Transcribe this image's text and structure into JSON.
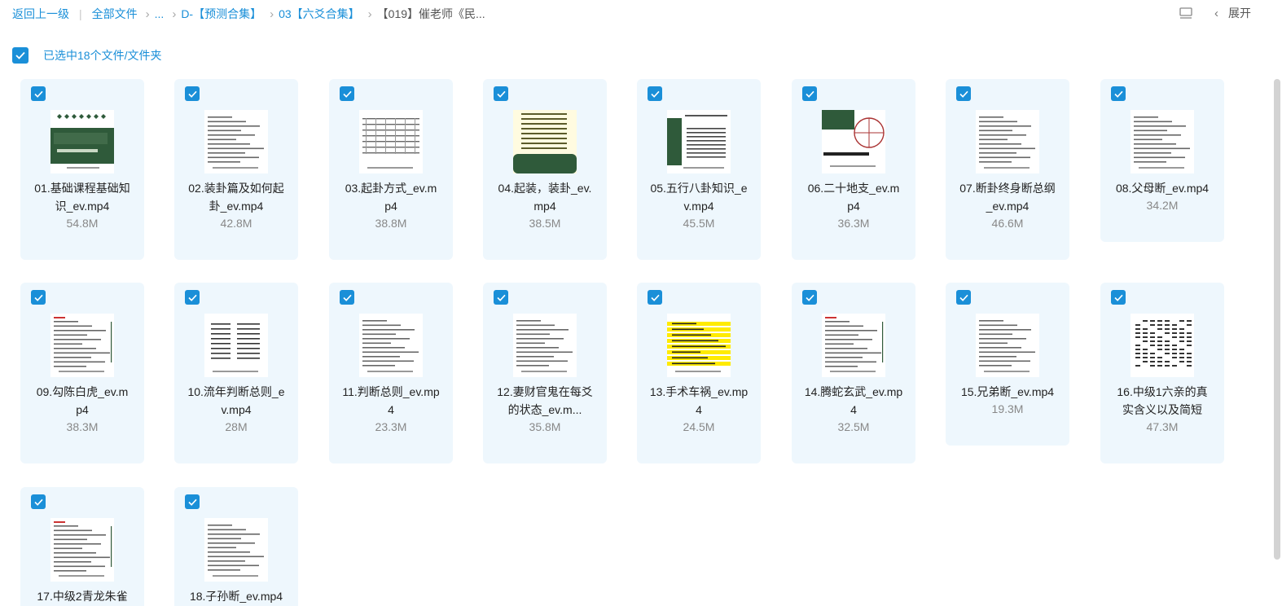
{
  "breadcrumb": {
    "back": "返回上一级",
    "root": "全部文件",
    "ellipsis": "...",
    "level1": "D-【预测合集】",
    "level2": "03【六爻合集】",
    "current": "【019】催老师《民..."
  },
  "toolbar": {
    "expand_label": "展开",
    "view_icon": "list-view-icon",
    "collapse_icon": "chevron-left-icon"
  },
  "selection": {
    "label": "已选中18个文件/文件夹",
    "checked": true
  },
  "accent_color": "#1a8fd8",
  "files": [
    {
      "name": "01.基础课程基础知识_ev.mp4",
      "line1": "01.基础课程基础知",
      "line2": "识_ev.mp4",
      "size": "54.8M",
      "thumb": "green-title"
    },
    {
      "name": "02.装卦篇及如何起卦_ev.mp4",
      "line1": "02.装卦篇及如何起",
      "line2": "卦_ev.mp4",
      "size": "42.8M",
      "thumb": "text"
    },
    {
      "name": "03.起卦方式_ev.mp4",
      "line1": "03.起卦方式_ev.m",
      "line2": "p4",
      "size": "38.8M",
      "thumb": "table"
    },
    {
      "name": "04.起装，装卦_ev.mp4",
      "line1": "04.起装，装卦_ev.",
      "line2": "mp4",
      "size": "38.5M",
      "thumb": "yellow-table"
    },
    {
      "name": "05.五行八卦知识_ev.mp4",
      "line1": "05.五行八卦知识_e",
      "line2": "v.mp4",
      "size": "45.5M",
      "thumb": "green-side"
    },
    {
      "name": "06.二十地支_ev.mp4",
      "line1": "06.二十地支_ev.m",
      "line2": "p4",
      "size": "36.3M",
      "thumb": "green-diagram"
    },
    {
      "name": "07.断卦终身断总纲_ev.mp4",
      "line1": "07.断卦终身断总纲",
      "line2": "_ev.mp4",
      "size": "46.6M",
      "thumb": "text"
    },
    {
      "name": "08.父母断_ev.mp4",
      "line1": "08.父母断_ev.mp4",
      "line2": "",
      "size": "34.2M",
      "thumb": "text"
    },
    {
      "name": "09.勾陈白虎_ev.mp4",
      "line1": "09.勾陈白虎_ev.m",
      "line2": "p4",
      "size": "38.3M",
      "thumb": "text-red"
    },
    {
      "name": "10.流年判断总则_ev.mp4",
      "line1": "10.流年判断总则_e",
      "line2": "v.mp4",
      "size": "28M",
      "thumb": "lines"
    },
    {
      "name": "11.判断总则_ev.mp4",
      "line1": "11.判断总则_ev.mp",
      "line2": "4",
      "size": "23.3M",
      "thumb": "text"
    },
    {
      "name": "12.妻财官鬼在每爻的状态_ev.mp4",
      "line1": "12.妻财官鬼在每爻",
      "line2": "的状态_ev.m...",
      "size": "35.8M",
      "thumb": "text"
    },
    {
      "name": "13.手术车祸_ev.mp4",
      "line1": "13.手术车祸_ev.mp",
      "line2": "4",
      "size": "24.5M",
      "thumb": "yellow-lines"
    },
    {
      "name": "14.腾蛇玄武_ev.mp4",
      "line1": "14.腾蛇玄武_ev.mp",
      "line2": "4",
      "size": "32.5M",
      "thumb": "text-red"
    },
    {
      "name": "15.兄弟断_ev.mp4",
      "line1": "15.兄弟断_ev.mp4",
      "line2": "",
      "size": "19.3M",
      "thumb": "text"
    },
    {
      "name": "16.中级1六亲的真实含义以及简短",
      "line1": "16.中级1六亲的真",
      "line2": "实含义以及简短",
      "size": "47.3M",
      "thumb": "dense"
    },
    {
      "name": "17.中级2青龙朱雀",
      "line1": "17.中级2青龙朱雀",
      "line2": "",
      "size": "",
      "thumb": "text-red"
    },
    {
      "name": "18.子孙断_ev.mp4",
      "line1": "18.子孙断_ev.mp4",
      "line2": "",
      "size": "",
      "thumb": "text"
    }
  ]
}
